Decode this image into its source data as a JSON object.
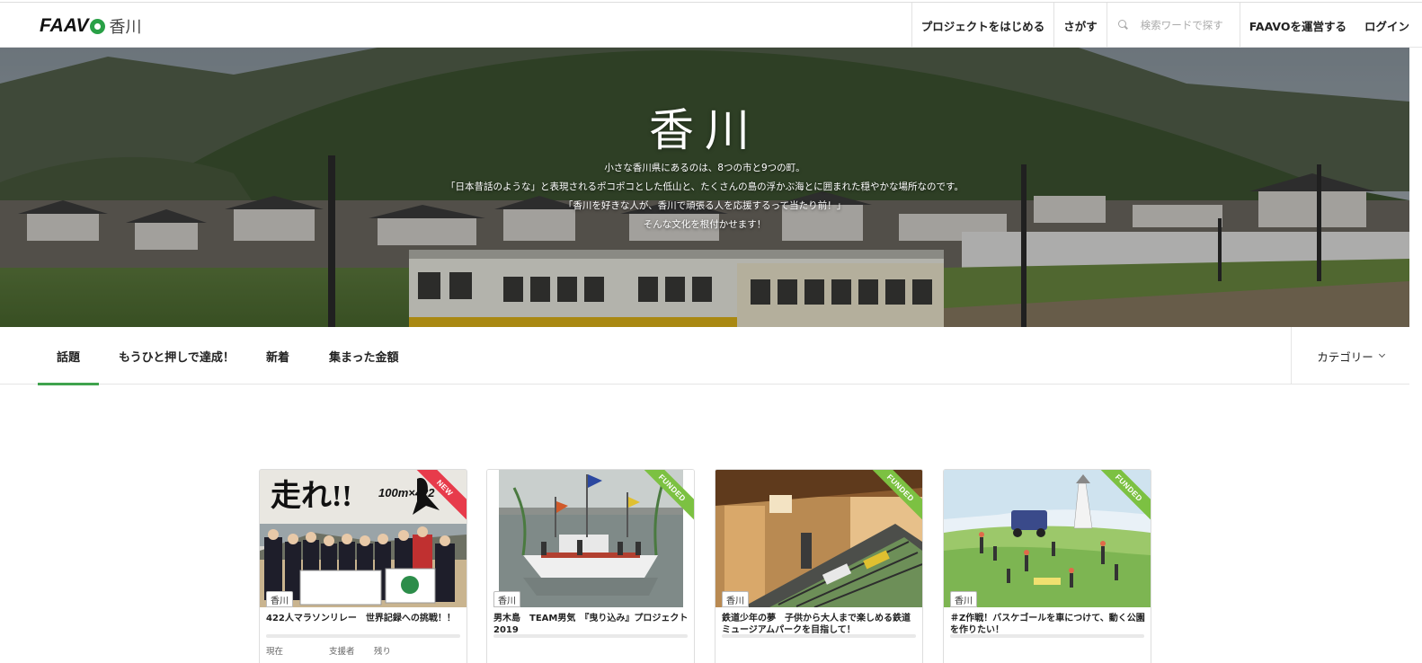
{
  "header": {
    "logo_text": "FAAV",
    "area": "香川",
    "nav": {
      "start_project": "プロジェクトをはじめる",
      "search_link": "さがす",
      "search_placeholder": "検索ワードで探す",
      "operate": "FAAVOを運営する",
      "login": "ログイン"
    }
  },
  "hero": {
    "title": "香川",
    "lines": [
      "小さな香川県にあるのは、8つの市と9つの町。",
      "「日本昔話のような」と表現されるポコポコとした低山と、たくさんの島の浮かぶ海とに囲まれた穏やかな場所なのです。",
      "「香川を好きな人が、香川で頑張る人を応援するって当たり前！」",
      "そんな文化を根付かせます！"
    ]
  },
  "tabs": {
    "items": [
      "話題",
      "もうひと押しで達成！",
      "新着",
      "集まった金額"
    ],
    "category": "カテゴリー"
  },
  "cards": [
    {
      "ribbon": "NEW",
      "area": "香川",
      "title": "422人マラソンリレー　世界記録への挑戦！！",
      "image_text": "走れ!!",
      "image_sub": "100m×422",
      "stats": {
        "current": "現在",
        "supporters": "支援者",
        "remaining": "残り"
      }
    },
    {
      "ribbon": "FUNDED",
      "area": "香川",
      "title": "男木島　TEAM男気　『曳り込み』プロジェクト2019"
    },
    {
      "ribbon": "FUNDED",
      "area": "香川",
      "title": "鉄道少年の夢　子供から大人まで楽しめる鉄道ミュージアムパークを目指して！"
    },
    {
      "ribbon": "FUNDED",
      "area": "香川",
      "title": "＃Z作戦！バスケゴールを車につけて、動く公園を作りたい！"
    }
  ],
  "colors": {
    "accent": "#3fa34d",
    "new_ribbon": "#e73b4b",
    "funded_ribbon": "#7cc142"
  }
}
